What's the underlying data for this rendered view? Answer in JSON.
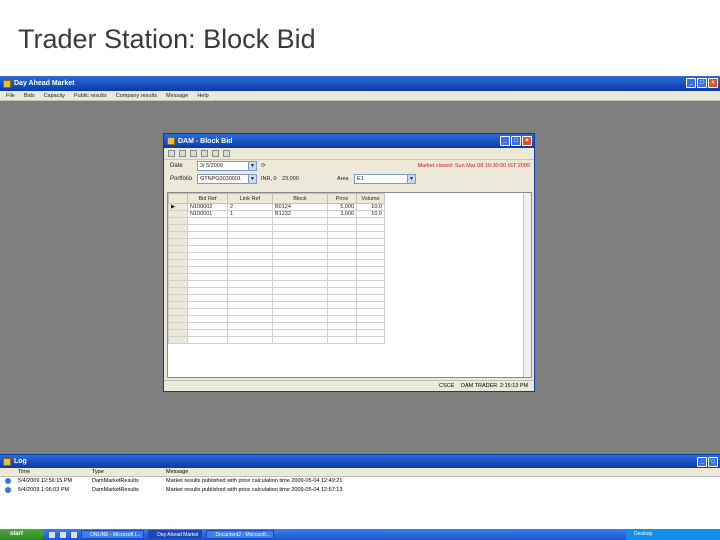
{
  "slide_title": "Trader Station: Block Bid",
  "app": {
    "title": "Day Ahead Market",
    "menu": [
      "File",
      "Bids",
      "Capacity",
      "Public results",
      "Company results",
      "Message",
      "Help"
    ]
  },
  "block_bid": {
    "title": "DAM - Block Bid",
    "date_label": "Date",
    "date_value": "3/ 5/2009",
    "portfolio_label": "Portfolio",
    "portfolio_value": "GTNPG0030001",
    "currency_text": "INR, 0",
    "amount_text": "23,000",
    "area_label": "Area",
    "area_value": "E1",
    "market_status": "Market closed: Sun Mar 08 10:30:00 IST 2009",
    "columns": [
      "Bid Ref",
      "Link Ref",
      "Block",
      "Price",
      "Volume"
    ],
    "rows": [
      {
        "bid_ref": "N100002",
        "link_ref": "2",
        "block": "B0124",
        "price": "5,000",
        "volume": "10.0"
      },
      {
        "bid_ref": "N100001",
        "link_ref": "1",
        "block": "B1232",
        "price": "3,000",
        "volume": "10.0"
      }
    ],
    "status_bar": {
      "area": "CSCE",
      "user": "DAM TRADER",
      "time": "2:15:13 PM"
    }
  },
  "log": {
    "title": "Log",
    "columns": [
      "Time",
      "Type",
      "Message"
    ],
    "rows": [
      {
        "time": "5/4/2009 12:56:15 PM",
        "type": "DamMarketResults",
        "message": "Market results published with price calculation time 2009-05-04 12:49:21"
      },
      {
        "time": "5/4/2009 1:06:03 PM",
        "type": "DamMarketResults",
        "message": "Market results published with price calculation time 2009-05-04 12:57:13"
      }
    ]
  },
  "taskbar": {
    "start": "start",
    "tasks": [
      "ONLINE - Microsoft I...",
      "Day Ahead Market",
      "Document2 - Microsoft..."
    ],
    "tray_text": "Desktop"
  }
}
